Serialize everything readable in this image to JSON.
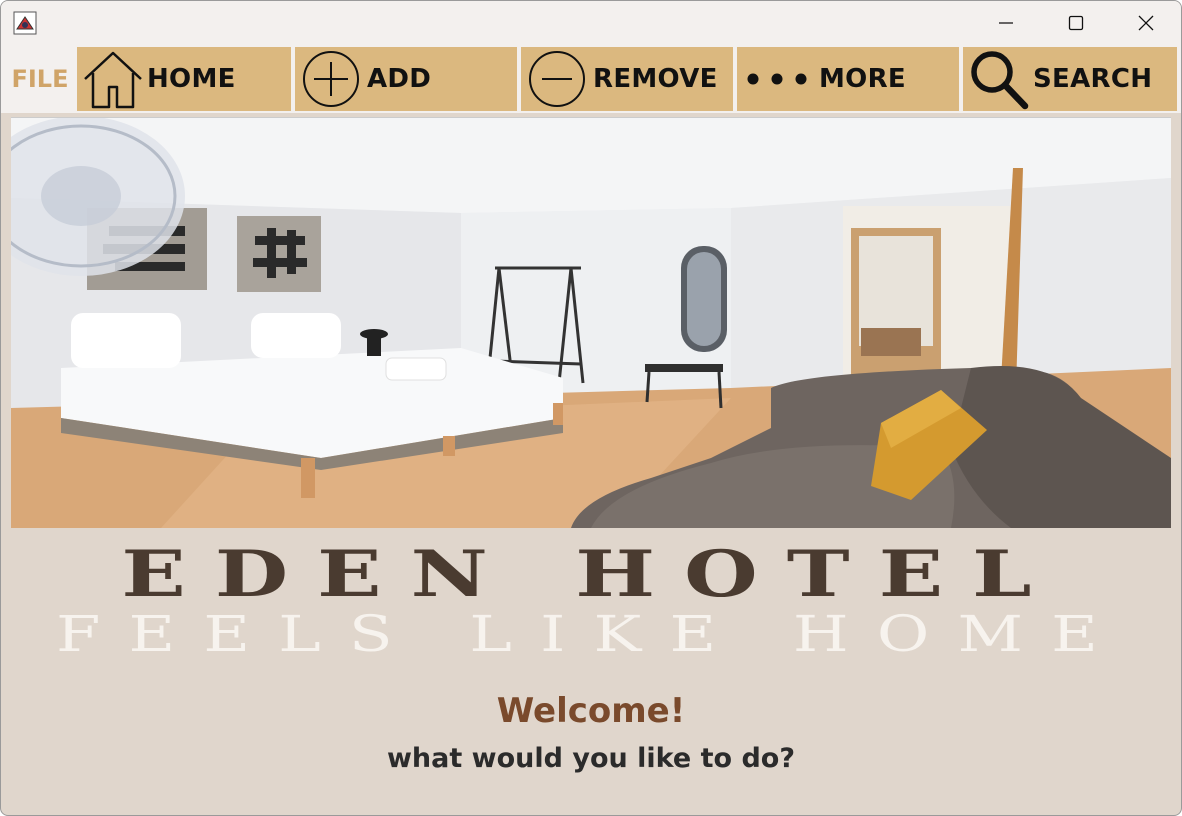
{
  "window": {
    "controls": [
      "minimize-icon",
      "maximize-icon",
      "close-icon"
    ]
  },
  "toolbar": {
    "file_label": "FILE",
    "buttons": [
      {
        "label": "HOME",
        "icon": "home-icon"
      },
      {
        "label": "ADD",
        "icon": "add-circle-icon"
      },
      {
        "label": "REMOVE",
        "icon": "remove-circle-icon"
      },
      {
        "label": "MORE",
        "icon": "more-dots-icon"
      },
      {
        "label": "SEARCH",
        "icon": "search-icon"
      }
    ]
  },
  "hero": {
    "image": "hotel-room-photo"
  },
  "brand": {
    "name": "EDEN HOTEL",
    "tagline": "FEELS LIKE HOME"
  },
  "greeting": {
    "welcome": "Welcome!",
    "question": "what would you like to do?"
  },
  "colors": {
    "toolbar_button": "#dbb87f",
    "file_label": "#d0a468",
    "content_bg": "#e0d6cc",
    "welcome_text": "#7a4a2c"
  }
}
